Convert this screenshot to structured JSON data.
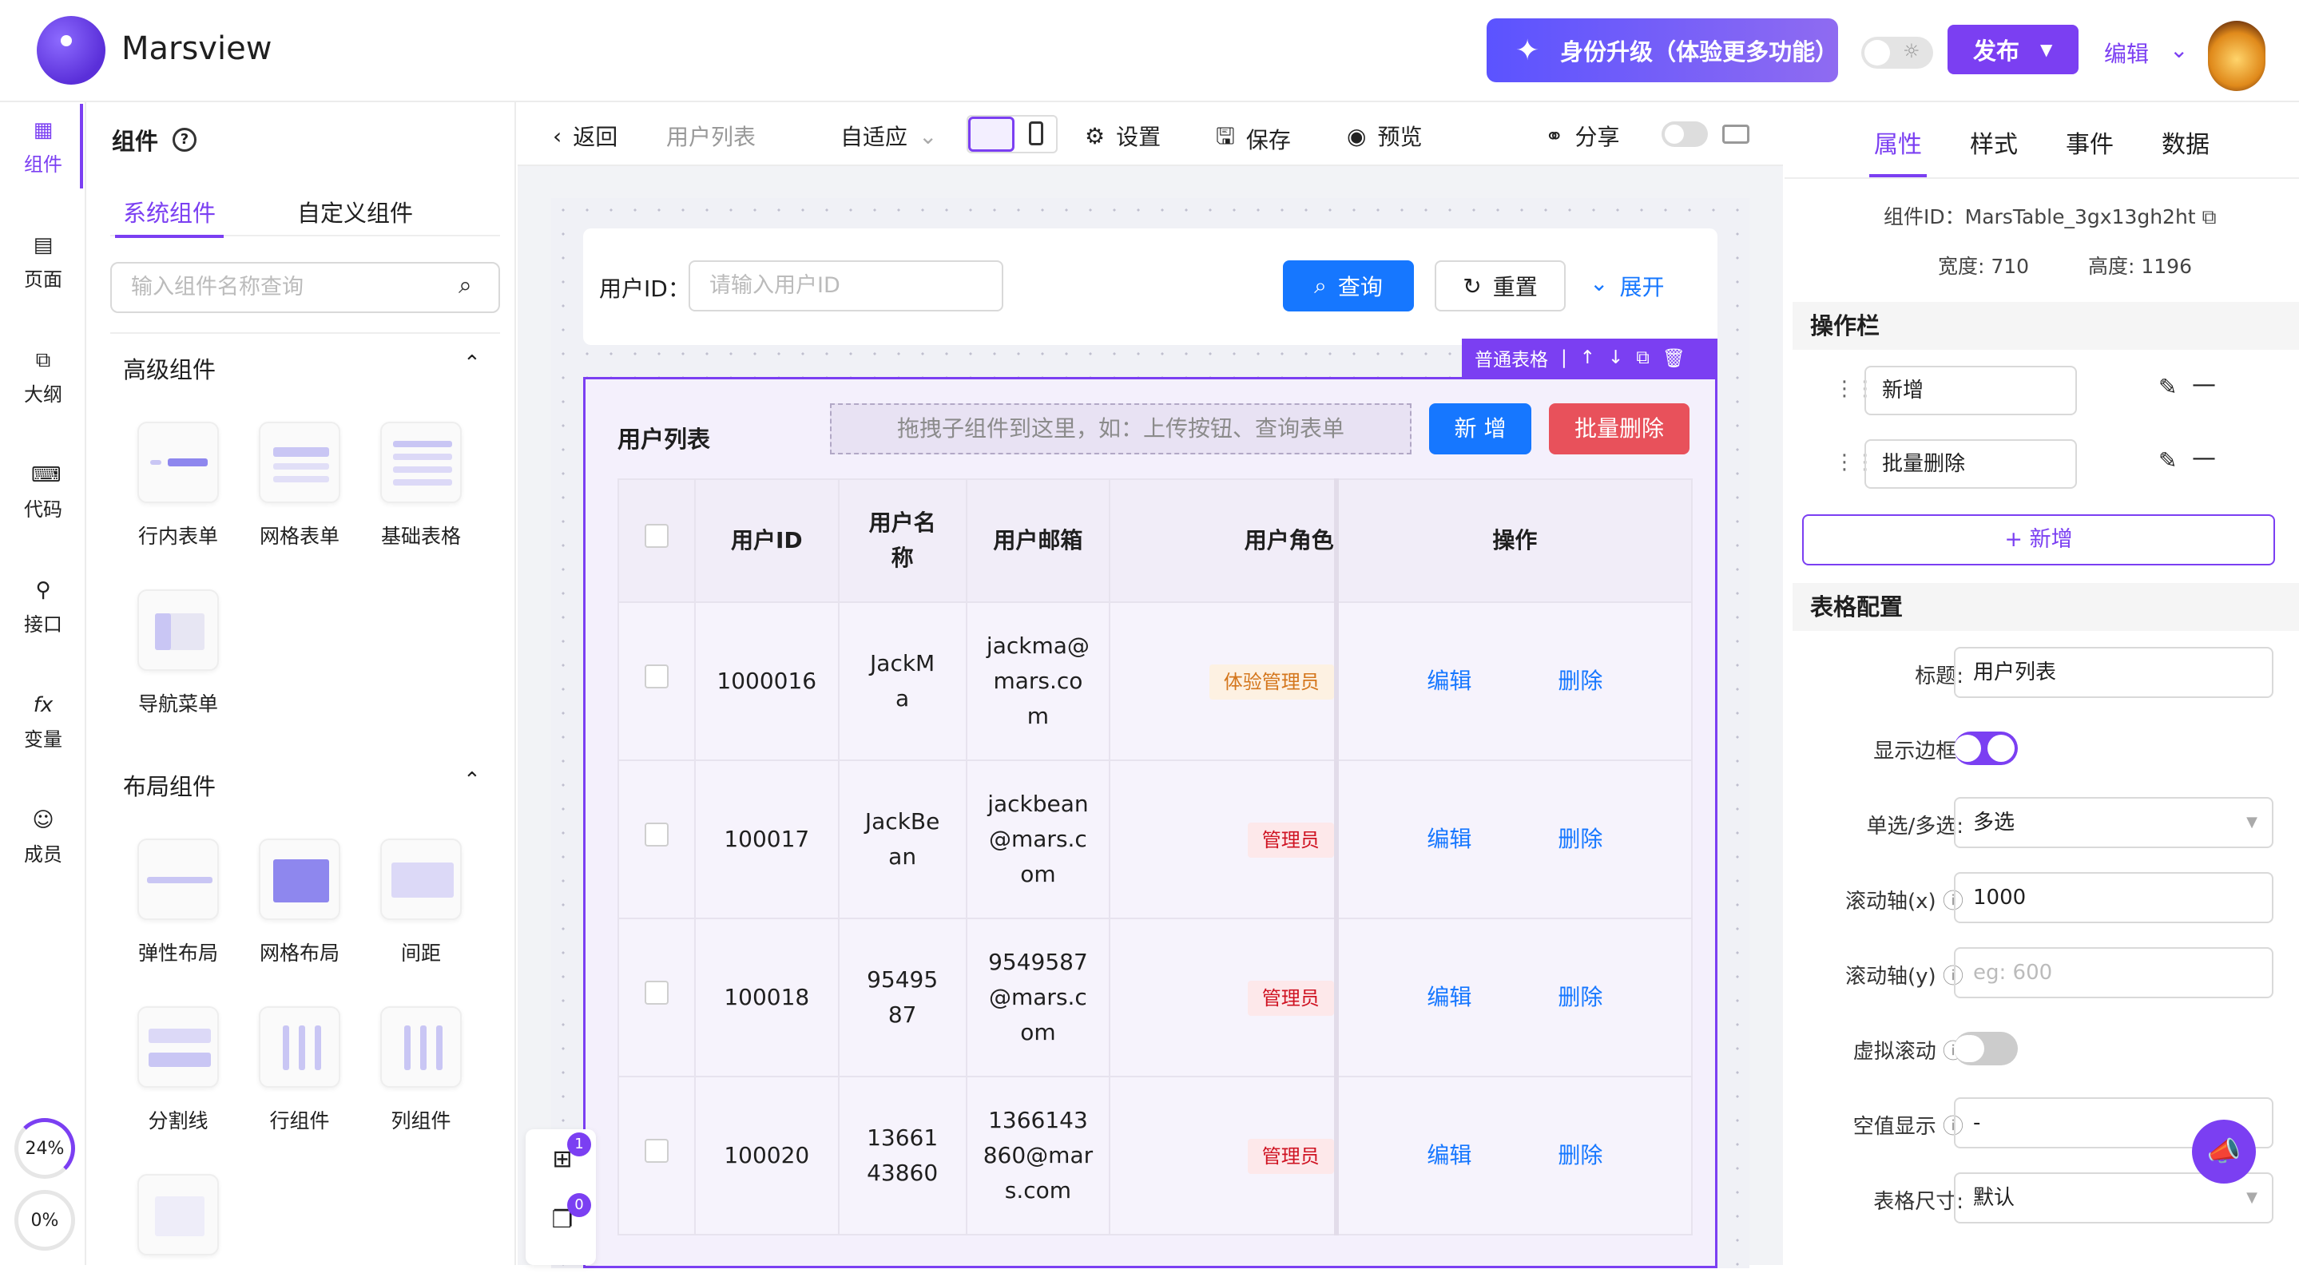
{
  "app": {
    "name": "Marsview",
    "upgrade": "身份升级（体验更多功能）",
    "publish": "发布",
    "edit": "编辑"
  },
  "rail": [
    {
      "label": "组件",
      "icon": "grid-icon"
    },
    {
      "label": "页面",
      "icon": "page-icon"
    },
    {
      "label": "大纲",
      "icon": "outline-icon"
    },
    {
      "label": "代码",
      "icon": "code-icon"
    },
    {
      "label": "接口",
      "icon": "api-icon"
    },
    {
      "label": "变量",
      "icon": "fx-icon"
    },
    {
      "label": "成员",
      "icon": "member-icon"
    }
  ],
  "progress": [
    "24%",
    "0%"
  ],
  "left": {
    "title": "组件",
    "tabs": [
      "系统组件",
      "自定义组件"
    ],
    "search_placeholder": "输入组件名称查询",
    "sec1": "高级组件",
    "sec1_items": [
      "行内表单",
      "网格表单",
      "基础表格",
      "导航菜单"
    ],
    "sec2": "布局组件",
    "sec2_items": [
      "弹性布局",
      "网格布局",
      "间距",
      "分割线",
      "行组件",
      "列组件"
    ]
  },
  "toolbar": {
    "back": "返回",
    "page": "用户列表",
    "fit": "自适应",
    "settings": "设置",
    "save": "保存",
    "preview": "预览",
    "share": "分享"
  },
  "form": {
    "label": "用户ID：",
    "placeholder": "请输入用户ID",
    "query": "查询",
    "reset": "重置",
    "expand": "展开"
  },
  "selected": {
    "label": "普通表格"
  },
  "table": {
    "title": "用户列表",
    "drop": "拖拽子组件到这里，如：上传按钮、查询表单",
    "add": "新 增",
    "batch": "批量删除",
    "headers": [
      "用户ID",
      "用户名称",
      "用户邮箱",
      "用户角色",
      "操作"
    ],
    "rows": [
      {
        "id": "1000016",
        "name": "JackMa",
        "email": "jackma@mars.com",
        "role": "体验管理员",
        "rolecolor": "#d4761c",
        "rolebg": "#fdf1e2"
      },
      {
        "id": "100017",
        "name": "JackBean",
        "email": "jackbean@mars.com",
        "role": "管理员",
        "rolecolor": "#cf1322",
        "rolebg": "#fde8ea"
      },
      {
        "id": "100018",
        "name": "9549587",
        "email": "9549587@mars.com",
        "role": "管理员",
        "rolecolor": "#cf1322",
        "rolebg": "#fde8ea"
      },
      {
        "id": "100020",
        "name": "1366143860",
        "email": "1366143860@mars.com",
        "role": "管理员",
        "rolecolor": "#cf1322",
        "rolebg": "#fde8ea"
      }
    ],
    "edit": "编辑",
    "del": "删除"
  },
  "floats": {
    "a": "1",
    "b": "0"
  },
  "right": {
    "tabs": [
      "属性",
      "样式",
      "事件",
      "数据"
    ],
    "cid": "组件ID：MarsTable_3gx13gh2ht",
    "width": "宽度: 710",
    "height": "高度: 1196",
    "ops_title": "操作栏",
    "ops": [
      "新增",
      "批量删除"
    ],
    "add": "+ 新增",
    "cfg_title": "表格配置",
    "cfg": {
      "title_label": "标题:",
      "title_val": "用户列表",
      "border_label": "显示边框:",
      "sel_label": "单选/多选:",
      "sel_val": "多选",
      "sx_label": "滚动轴(x)",
      "sx_val": "1000",
      "sy_label": "滚动轴(y)",
      "sy_ph": "eg: 600",
      "vs_label": "虚拟滚动",
      "empty_label": "空值显示",
      "empty_val": "-",
      "size_label": "表格尺寸:",
      "size_val": "默认"
    }
  },
  "colors": {
    "accent": "#7b3ff2",
    "primary": "#1677ff",
    "danger": "#e8515b"
  }
}
